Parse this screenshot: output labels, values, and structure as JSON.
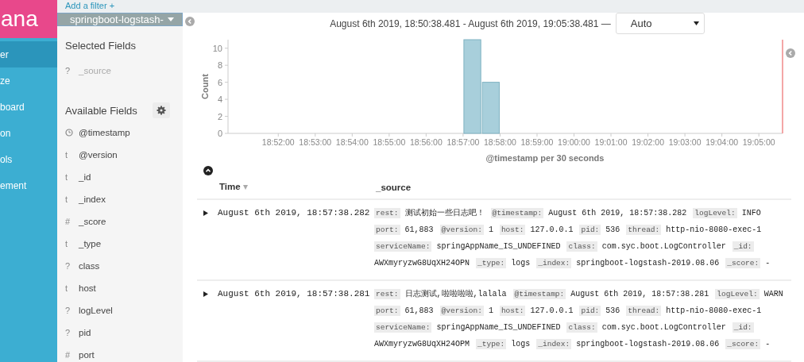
{
  "nav": {
    "logo": "ana",
    "items": [
      {
        "label": "er",
        "selected": true
      },
      {
        "label": "ze",
        "selected": false
      },
      {
        "label": "board",
        "selected": false
      },
      {
        "label": "on",
        "selected": false
      },
      {
        "label": "ols",
        "selected": false
      },
      {
        "label": "ement",
        "selected": false
      }
    ]
  },
  "filter_bar": {
    "add_filter": "Add a filter +"
  },
  "index_pattern": {
    "label": "springboot-logstash-"
  },
  "selected_fields": {
    "title": "Selected Fields",
    "items": [
      {
        "type": "?",
        "name": "_source"
      }
    ]
  },
  "available_fields": {
    "title": "Available Fields",
    "items": [
      {
        "kind": "date",
        "name": "@timestamp"
      },
      {
        "type": "t",
        "name": "@version"
      },
      {
        "type": "t",
        "name": "_id"
      },
      {
        "type": "t",
        "name": "_index"
      },
      {
        "type": "#",
        "name": "_score"
      },
      {
        "type": "t",
        "name": "_type"
      },
      {
        "type": "?",
        "name": "class"
      },
      {
        "type": "t",
        "name": "host"
      },
      {
        "type": "?",
        "name": "logLevel"
      },
      {
        "type": "?",
        "name": "pid"
      },
      {
        "type": "#",
        "name": "port"
      }
    ]
  },
  "time_range": "August 6th 2019, 18:50:38.481 - August 6th 2019, 19:05:38.481 —",
  "interval": {
    "value": "Auto"
  },
  "chart_data": {
    "type": "bar",
    "xlabel": "@timestamp per 30 seconds",
    "ylabel": "Count",
    "x": [
      1137.25,
      1137.75
    ],
    "values": [
      11,
      6
    ],
    "xlim": [
      1130.641,
      1145.641
    ],
    "ylim": [
      0,
      11
    ],
    "yticks": [
      0,
      2,
      4,
      6,
      8,
      10
    ],
    "xticks": [
      {
        "value": 1132,
        "label": "18:52:00"
      },
      {
        "value": 1133,
        "label": "18:53:00"
      },
      {
        "value": 1134,
        "label": "18:54:00"
      },
      {
        "value": 1135,
        "label": "18:55:00"
      },
      {
        "value": 1136,
        "label": "18:56:00"
      },
      {
        "value": 1137,
        "label": "18:57:00"
      },
      {
        "value": 1138,
        "label": "18:58:00"
      },
      {
        "value": 1139,
        "label": "18:59:00"
      },
      {
        "value": 1140,
        "label": "19:00:00"
      },
      {
        "value": 1141,
        "label": "19:01:00"
      },
      {
        "value": 1142,
        "label": "19:02:00"
      },
      {
        "value": 1143,
        "label": "19:03:00"
      },
      {
        "value": 1144,
        "label": "19:04:00"
      },
      {
        "value": 1145,
        "label": "19:05:00"
      }
    ]
  },
  "table": {
    "columns": [
      {
        "label": "Time",
        "sort": "▾"
      },
      {
        "label": "_source"
      }
    ],
    "rows": [
      {
        "time": "August 6th 2019, 18:57:38.282",
        "source": [
          {
            "key": "rest:",
            "value": "测试初始一些日志吧！"
          },
          {
            "key": "@timestamp:",
            "value": "August 6th 2019, 18:57:38.282"
          },
          {
            "key": "logLevel:",
            "value": "INFO"
          },
          {
            "key": "port:",
            "value": "61,883"
          },
          {
            "key": "@version:",
            "value": "1"
          },
          {
            "key": "host:",
            "value": "127.0.0.1"
          },
          {
            "key": "pid:",
            "value": "536"
          },
          {
            "key": "thread:",
            "value": "http-nio-8080-exec-1"
          },
          {
            "key": "serviceName:",
            "value": "springAppName_IS_UNDEFINED"
          },
          {
            "key": "class:",
            "value": "com.syc.boot.LogController"
          },
          {
            "key": "_id:",
            "value": "AWXmyryzwG8UqXH24OPN"
          },
          {
            "key": "_type:",
            "value": "logs"
          },
          {
            "key": "_index:",
            "value": "springboot-logstash-2019.08.06"
          },
          {
            "key": "_score:",
            "value": "-"
          }
        ]
      },
      {
        "time": "August 6th 2019, 18:57:38.281",
        "source": [
          {
            "key": "rest:",
            "value": "日志测试,啦啦啦啦,lalala"
          },
          {
            "key": "@timestamp:",
            "value": "August 6th 2019, 18:57:38.281"
          },
          {
            "key": "logLevel:",
            "value": "WARN"
          },
          {
            "key": "port:",
            "value": "61,883"
          },
          {
            "key": "@version:",
            "value": "1"
          },
          {
            "key": "host:",
            "value": "127.0.0.1"
          },
          {
            "key": "pid:",
            "value": "536"
          },
          {
            "key": "thread:",
            "value": "http-nio-8080-exec-1"
          },
          {
            "key": "serviceName:",
            "value": "springAppName_IS_UNDEFINED"
          },
          {
            "key": "class:",
            "value": "com.syc.boot.LogController"
          },
          {
            "key": "_id:",
            "value": "AWXmyryzwG8UqXH24OPM"
          },
          {
            "key": "_type:",
            "value": "logs"
          },
          {
            "key": "_index:",
            "value": "springboot-logstash-2019.08.06"
          },
          {
            "key": "_score:",
            "value": "-"
          }
        ]
      }
    ]
  }
}
